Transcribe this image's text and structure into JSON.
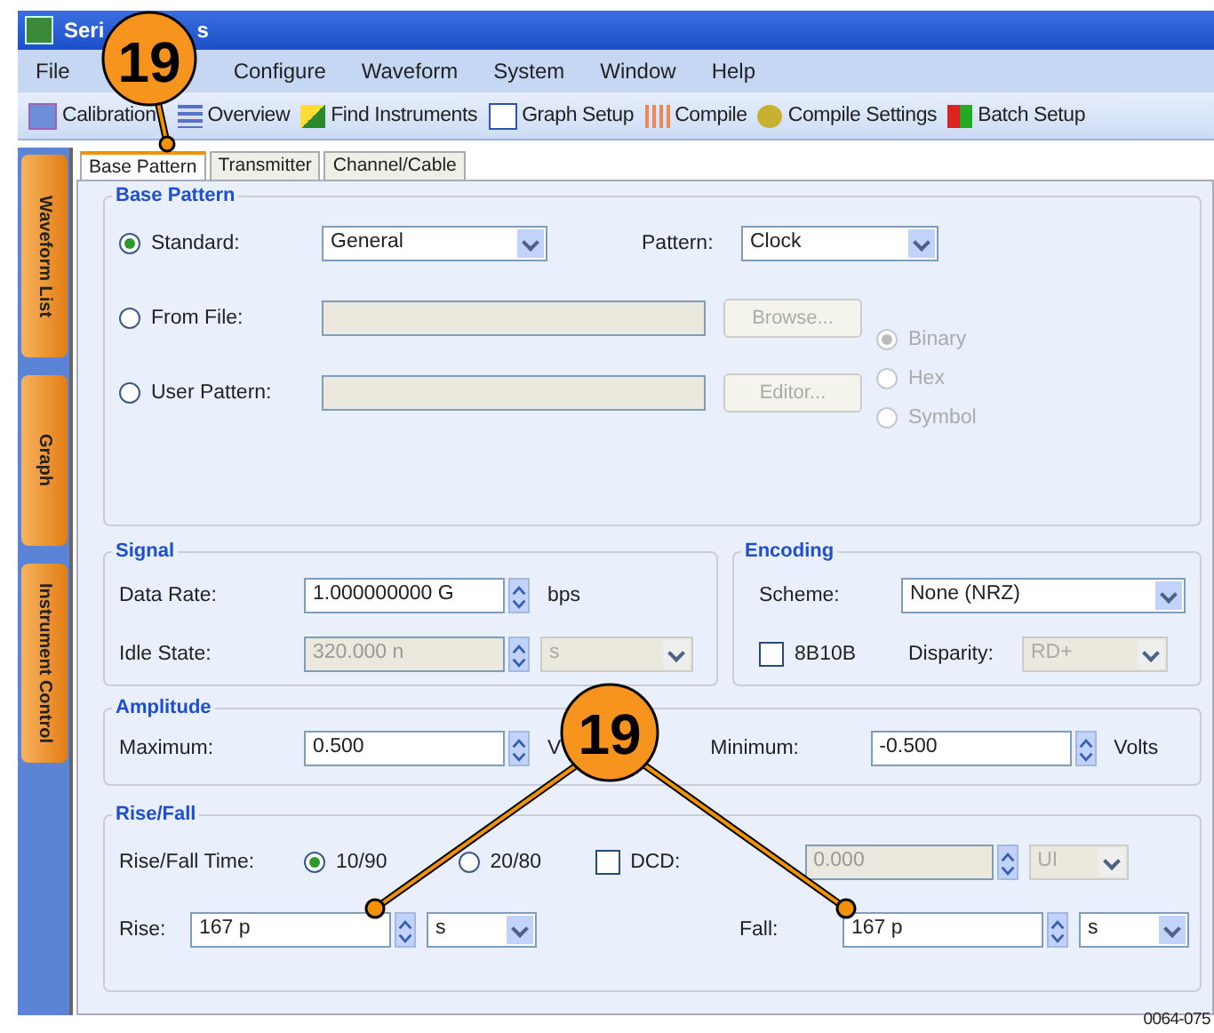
{
  "window": {
    "title_parts": [
      "Seri",
      "s"
    ]
  },
  "menu": [
    "File",
    "Configure",
    "Waveform",
    "System",
    "Window",
    "Help"
  ],
  "toolbar": [
    "Calibration",
    "Overview",
    "Find Instruments",
    "Graph Setup",
    "Compile",
    "Compile Settings",
    "Batch Setup"
  ],
  "side_tabs": [
    "Waveform List",
    "Graph",
    "Instrument Control"
  ],
  "tabs": [
    {
      "label": "Base Pattern",
      "selected": true
    },
    {
      "label": "Transmitter",
      "selected": false
    },
    {
      "label": "Channel/Cable",
      "selected": false
    }
  ],
  "base_pattern": {
    "title": "Base Pattern",
    "sources": [
      {
        "label": "Standard:",
        "selected": true
      },
      {
        "label": "From File:",
        "selected": false
      },
      {
        "label": "User Pattern:",
        "selected": false
      }
    ],
    "standard_value": "General",
    "pattern_label": "Pattern:",
    "pattern_value": "Clock",
    "browse": {
      "label": "Browse...",
      "disabled": true
    },
    "editor": {
      "label": "Editor...",
      "disabled": true
    },
    "formats": [
      {
        "label": "Binary",
        "selected": true,
        "disabled": true
      },
      {
        "label": "Hex",
        "selected": false,
        "disabled": true
      },
      {
        "label": "Symbol",
        "selected": false,
        "disabled": true
      }
    ]
  },
  "signal": {
    "title": "Signal",
    "data_rate": {
      "label": "Data Rate:",
      "value": "1.000000000 G",
      "unit": "bps",
      "disabled": false
    },
    "idle_state": {
      "label": "Idle State:",
      "value": "320.000 n",
      "unit": "s",
      "disabled": true
    }
  },
  "encoding": {
    "title": "Encoding",
    "scheme_label": "Scheme:",
    "scheme_value": "None (NRZ)",
    "b8b10": {
      "label": "8B10B",
      "checked": false
    },
    "disparity": {
      "label": "Disparity:",
      "value": "RD+",
      "disabled": true
    }
  },
  "amplitude": {
    "title": "Amplitude",
    "maximum": {
      "label": "Maximum:",
      "value": "0.500",
      "unit": "V"
    },
    "minimum": {
      "label": "Minimum:",
      "value": "-0.500",
      "unit": "Volts"
    }
  },
  "rise_fall": {
    "title": "Rise/Fall",
    "time_label": "Rise/Fall Time:",
    "time_options": [
      {
        "label": "10/90",
        "selected": true
      },
      {
        "label": "20/80",
        "selected": false
      }
    ],
    "dcd": {
      "label": "DCD:",
      "checked": false,
      "value": "0.000",
      "unit": "UI",
      "disabled": true
    },
    "rise": {
      "label": "Rise:",
      "value": "167 p",
      "unit": "s"
    },
    "fall": {
      "label": "Fall:",
      "value": "167 p",
      "unit": "s"
    }
  },
  "callouts": [
    {
      "label": "19"
    },
    {
      "label": "19"
    }
  ],
  "figure_id": "0064-075"
}
